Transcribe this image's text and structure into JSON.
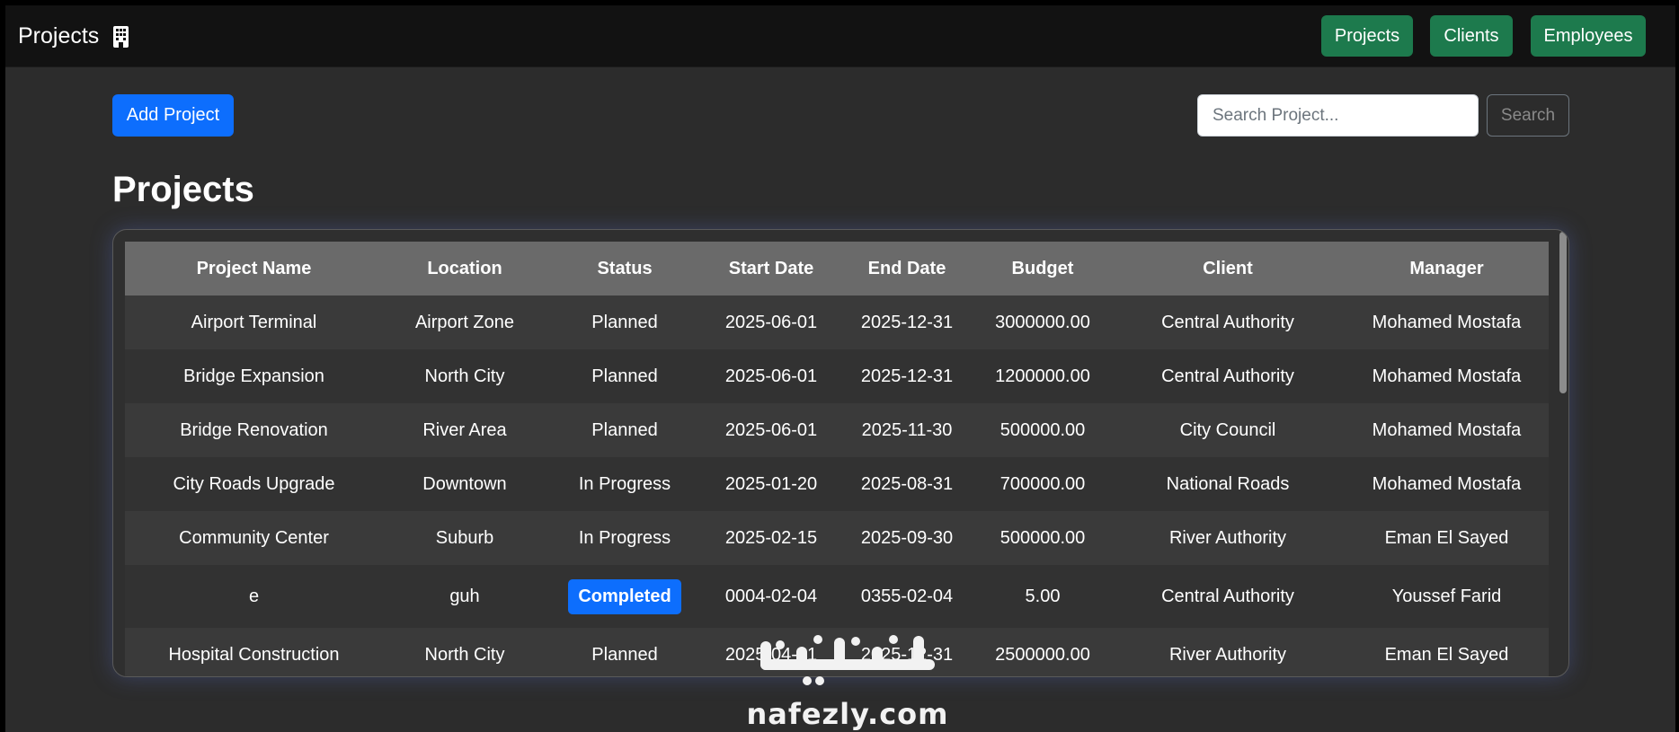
{
  "navbar": {
    "brand": "Projects",
    "brand_icon": "building-icon",
    "buttons": [
      "Projects",
      "Clients",
      "Employees"
    ],
    "button_color": "#1d7a4d"
  },
  "toolbar": {
    "add_label": "Add Project",
    "search_placeholder": "Search Project...",
    "search_value": "",
    "search_label": "Search",
    "accent": "#0d6efd"
  },
  "page_title": "Projects",
  "table": {
    "columns": [
      "Project Name",
      "Location",
      "Status",
      "Start Date",
      "End Date",
      "Budget",
      "Client",
      "Manager"
    ],
    "rows": [
      [
        "Airport Terminal",
        "Airport Zone",
        "Planned",
        "2025-06-01",
        "2025-12-31",
        "3000000.00",
        "Central Authority",
        "Mohamed Mostafa"
      ],
      [
        "Bridge Expansion",
        "North City",
        "Planned",
        "2025-06-01",
        "2025-12-31",
        "1200000.00",
        "Central Authority",
        "Mohamed Mostafa"
      ],
      [
        "Bridge Renovation",
        "River Area",
        "Planned",
        "2025-06-01",
        "2025-11-30",
        "500000.00",
        "City Council",
        "Mohamed Mostafa"
      ],
      [
        "City Roads Upgrade",
        "Downtown",
        "In Progress",
        "2025-01-20",
        "2025-08-31",
        "700000.00",
        "National Roads",
        "Mohamed Mostafa"
      ],
      [
        "Community Center",
        "Suburb",
        "In Progress",
        "2025-02-15",
        "2025-09-30",
        "500000.00",
        "River Authority",
        "Eman El Sayed"
      ],
      [
        "e",
        "guh",
        "Completed",
        "0004-02-04",
        "0355-02-04",
        "5.00",
        "Central Authority",
        "Youssef Farid"
      ],
      [
        "Hospital Construction",
        "North City",
        "Planned",
        "2025-04-01",
        "2025-12-31",
        "2500000.00",
        "River Authority",
        "Eman El Sayed"
      ]
    ],
    "badge_status": "Completed",
    "badge_color": "#0d6efd"
  },
  "watermark": {
    "arabic": "نفذلي",
    "latin": "nafezly.com"
  }
}
